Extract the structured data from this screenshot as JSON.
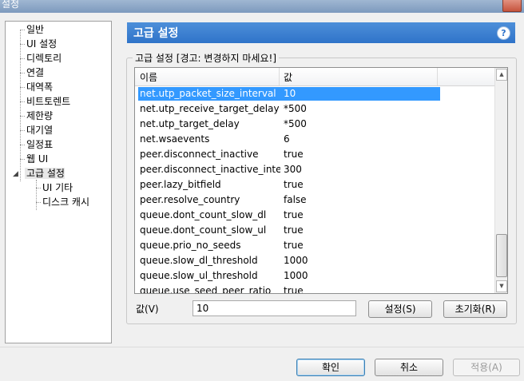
{
  "window": {
    "title": "설정"
  },
  "tree": {
    "items": [
      {
        "label": "일반"
      },
      {
        "label": "UI 설정"
      },
      {
        "label": "디렉토리"
      },
      {
        "label": "연결"
      },
      {
        "label": "대역폭"
      },
      {
        "label": "비트토렌트"
      },
      {
        "label": "제한량"
      },
      {
        "label": "대기열"
      },
      {
        "label": "일정표"
      },
      {
        "label": "웹 UI"
      },
      {
        "label": "고급 설정"
      }
    ],
    "children": [
      {
        "label": "UI 기타"
      },
      {
        "label": "디스크 캐시"
      }
    ]
  },
  "header": {
    "title": "고급 설정",
    "help": "?"
  },
  "group": {
    "legend": "고급 설정 [경고: 변경하지 마세요!]"
  },
  "list": {
    "columns": [
      "이름",
      "값"
    ],
    "rows": [
      {
        "name": "net.utp_packet_size_interval",
        "value": "10"
      },
      {
        "name": "net.utp_receive_target_delay",
        "value": "*500"
      },
      {
        "name": "net.utp_target_delay",
        "value": "*500"
      },
      {
        "name": "net.wsaevents",
        "value": "6"
      },
      {
        "name": "peer.disconnect_inactive",
        "value": "true"
      },
      {
        "name": "peer.disconnect_inactive_inter...",
        "value": "300"
      },
      {
        "name": "peer.lazy_bitfield",
        "value": "true"
      },
      {
        "name": "peer.resolve_country",
        "value": "false"
      },
      {
        "name": "queue.dont_count_slow_dl",
        "value": "true"
      },
      {
        "name": "queue.dont_count_slow_ul",
        "value": "true"
      },
      {
        "name": "queue.prio_no_seeds",
        "value": "true"
      },
      {
        "name": "queue.slow_dl_threshold",
        "value": "1000"
      },
      {
        "name": "queue.slow_ul_threshold",
        "value": "1000"
      },
      {
        "name": "queue.use_seed_peer_ratio",
        "value": "true"
      }
    ]
  },
  "value_editor": {
    "label": "값(V)",
    "value": "10",
    "set_button": "설정(S)",
    "reset_button": "초기화(R)"
  },
  "footer": {
    "ok": "확인",
    "cancel": "취소",
    "apply": "적용(A)"
  }
}
